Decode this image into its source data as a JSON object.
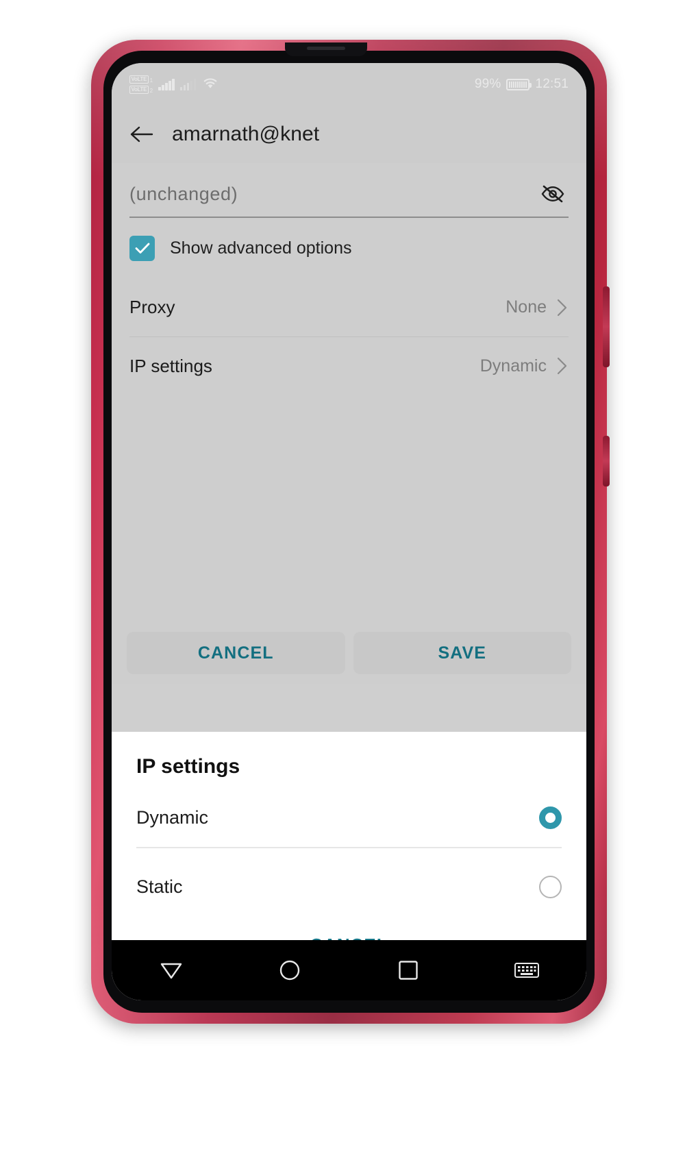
{
  "statusbar": {
    "volte1_label": "VoLTE",
    "volte1_sim": "1",
    "volte2_label": "VoLTE",
    "volte2_sim": "2",
    "battery_percent": "99%",
    "time": "12:51",
    "signal_icon": "signal-bars-icon",
    "wifi_icon": "wifi-icon",
    "battery_icon": "battery-icon"
  },
  "appbar": {
    "title": "amarnath@knet",
    "back_icon": "back-arrow-icon"
  },
  "form": {
    "password_value": "(unchanged)",
    "password_placeholder": "(unchanged)",
    "toggle_visibility_icon": "eye-off-icon",
    "advanced_checkbox_label": "Show advanced options",
    "advanced_checkbox_checked": true,
    "rows": [
      {
        "label": "Proxy",
        "value": "None",
        "chevron_icon": "chevron-right-icon"
      },
      {
        "label": "IP settings",
        "value": "Dynamic",
        "chevron_icon": "chevron-right-icon"
      }
    ],
    "cancel_label": "CANCEL",
    "save_label": "SAVE"
  },
  "dialog": {
    "title": "IP settings",
    "options": [
      {
        "label": "Dynamic",
        "selected": true
      },
      {
        "label": "Static",
        "selected": false
      }
    ],
    "cancel_label": "CANCEL"
  },
  "keyboard": {
    "key_comma": ",",
    "key_space": "",
    "key_period": ".",
    "key_enter": ""
  },
  "navbar": {
    "back_icon": "nav-back-triangle-icon",
    "home_icon": "nav-home-circle-icon",
    "recents_icon": "nav-recents-square-icon",
    "keyboard_icon": "nav-keyboard-icon"
  },
  "colors": {
    "accent_teal": "#2f97ab",
    "action_teal": "#136f80",
    "screen_bg": "#cecece",
    "statusbar_bg": "#cccccc",
    "sheet_bg": "#ffffff",
    "phone_body": "#b32342"
  }
}
